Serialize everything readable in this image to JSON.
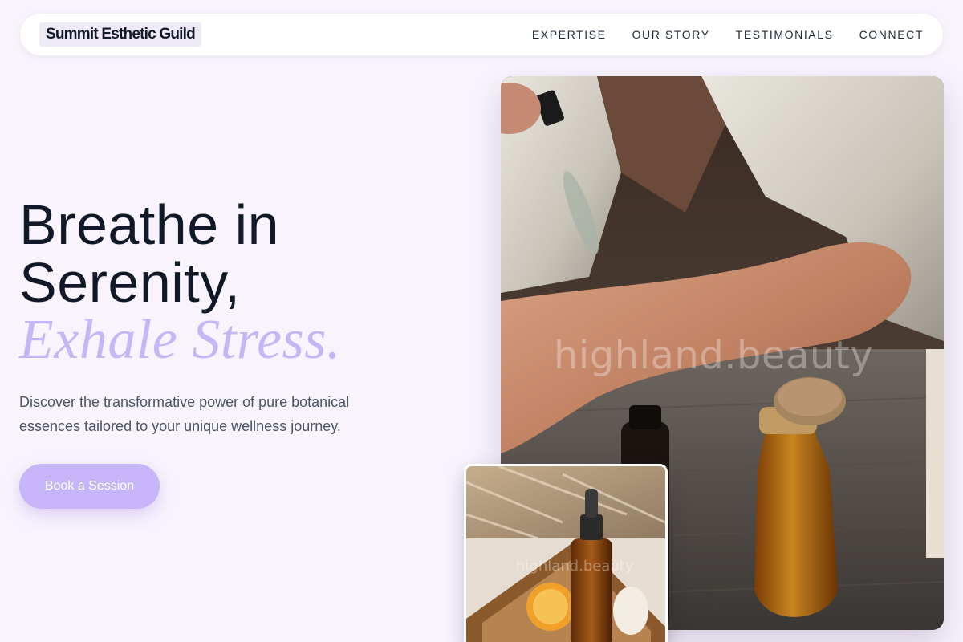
{
  "nav": {
    "brand": "Summit Esthetic Guild",
    "links": [
      "EXPERTISE",
      "OUR STORY",
      "TESTIMONIALS",
      "CONNECT"
    ]
  },
  "hero": {
    "headline_line1": "Breathe in",
    "headline_line2": "Serenity,",
    "headline_accent": "Exhale Stress.",
    "description": "Discover the transformative power of pure botanical essences tailored to your unique wellness journey.",
    "cta_label": "Book a Session"
  },
  "images": {
    "main_watermark": "highland.beauty",
    "small_watermark": "highland.beauty"
  },
  "colors": {
    "background": "#f8f3fd",
    "accent": "#c7b6f5",
    "button": "#c6b5f9",
    "text": "#111827"
  }
}
